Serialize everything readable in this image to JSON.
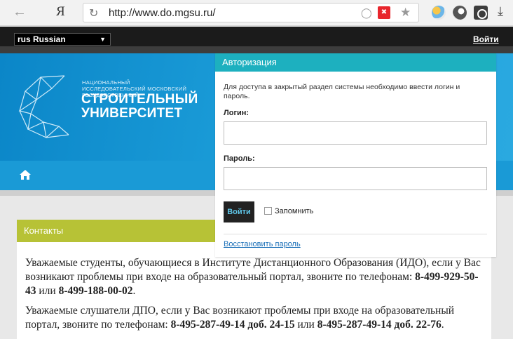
{
  "browser": {
    "back_icon": "arrow-left-icon",
    "yandex_label": "Я",
    "url": "http://www.do.mgsu.ru/",
    "reload_icon": "reload-icon"
  },
  "topbar": {
    "language": "rus Russian",
    "login_link": "Войти"
  },
  "banner": {
    "subtitle": "НАЦИОНАЛЬНЫЙ ИССЛЕДОВАТЕЛЬСКИЙ МОСКОВСКИЙ ГОСУДАРСТВЕННЫЙ",
    "title_line1": "СТРОИТЕЛЬНЫЙ",
    "title_line2": "УНИВЕРСИТЕТ"
  },
  "auth": {
    "title": "Авторизация",
    "description": "Для доступа в закрытый раздел системы необходимо ввести логин и пароль.",
    "login_label": "Логин:",
    "login_value": "",
    "password_label": "Пароль:",
    "password_value": "",
    "submit_label": "Войти",
    "remember_label": "Запомнить",
    "restore_link": "Восстановить пароль"
  },
  "contacts": {
    "title": "Контакты",
    "p1_text": "Уважаемые студенты, обучающиеся в Институте Дистанционного Образования (ИДО), если у Вас возникают проблемы при входе на образовательный портал, звоните по телефонам: ",
    "p1_phone1": "8-499-929-50-43",
    "p1_or": " или ",
    "p1_phone2": "8-499-188-00-02",
    "p1_end": ".",
    "p2_text": "Уважаемые слушатели ДПО, если у Вас возникают проблемы при входе на образовательный портал, звоните по телефонам: ",
    "p2_phone1": "8-495-287-49-14 доб. 24-15",
    "p2_or": " или ",
    "p2_phone2": "8-495-287-49-14 доб. 22-76",
    "p2_end": "."
  },
  "colors": {
    "banner_blue": "#1fa2dc",
    "auth_header": "#1db0bf",
    "contacts_header": "#b7c236"
  }
}
